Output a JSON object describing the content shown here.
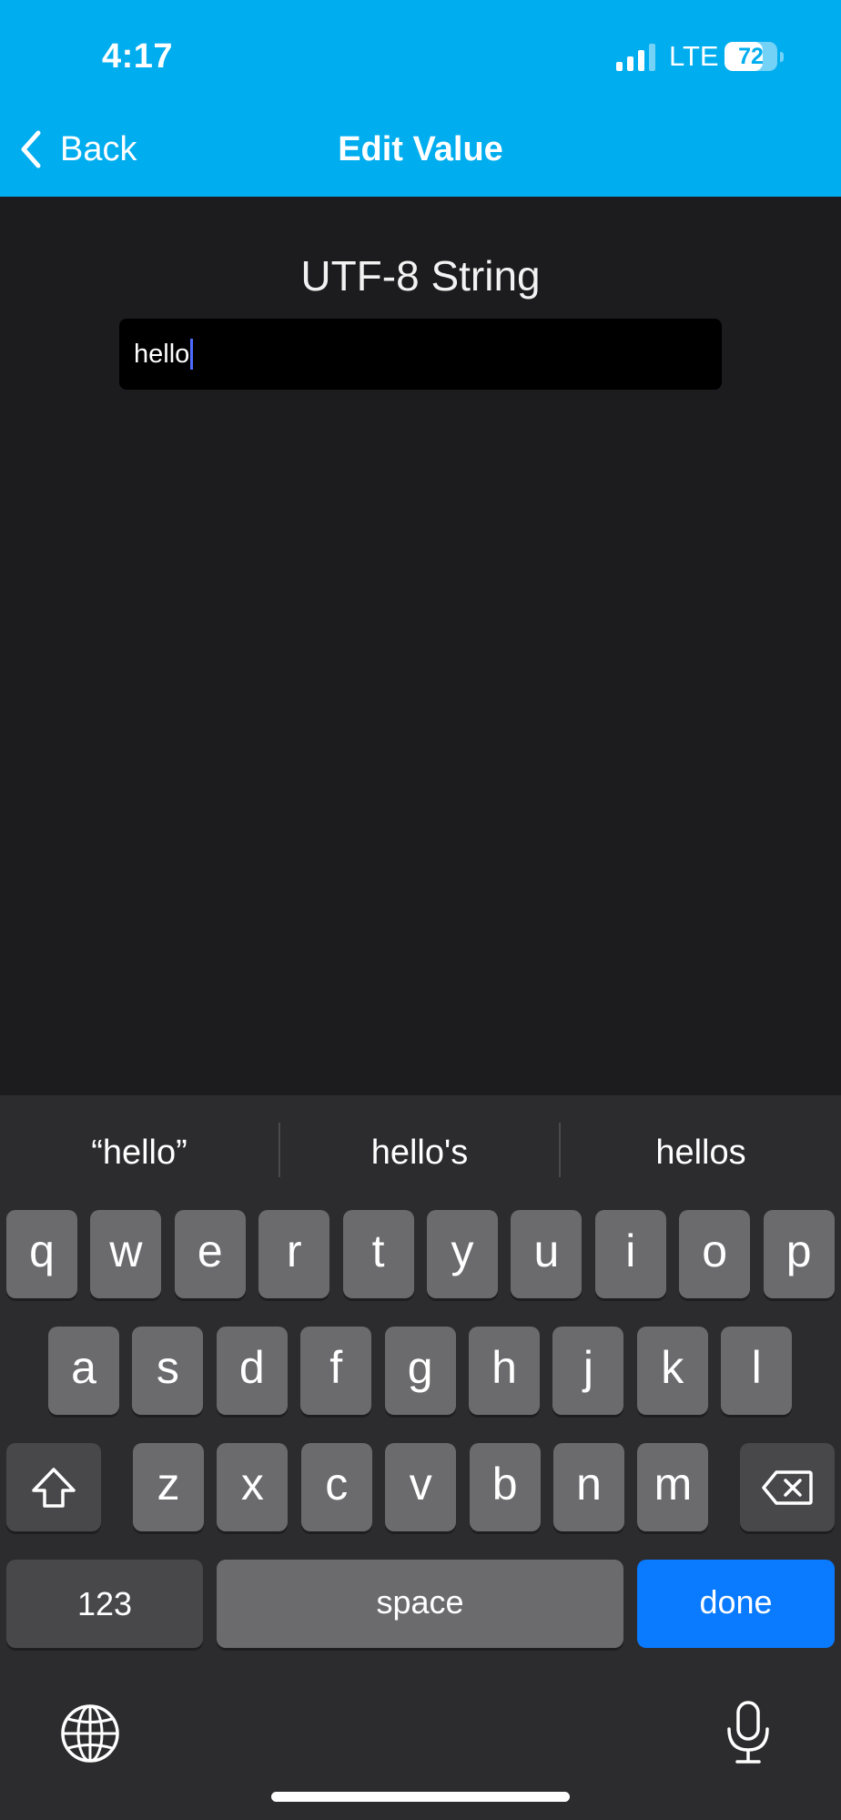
{
  "status_bar": {
    "time": "4:17",
    "network": "LTE",
    "battery_level": "72",
    "battery_fraction": 0.72
  },
  "nav": {
    "back_label": "Back",
    "title": "Edit Value"
  },
  "editor": {
    "field_label": "UTF-8 String",
    "value": "hello"
  },
  "keyboard": {
    "suggestions": [
      "“hello”",
      "hello's",
      "hellos"
    ],
    "row1": [
      "q",
      "w",
      "e",
      "r",
      "t",
      "y",
      "u",
      "i",
      "o",
      "p"
    ],
    "row2": [
      "a",
      "s",
      "d",
      "f",
      "g",
      "h",
      "j",
      "k",
      "l"
    ],
    "row3": [
      "z",
      "x",
      "c",
      "v",
      "b",
      "n",
      "m"
    ],
    "numbers_label": "123",
    "space_label": "space",
    "done_label": "done"
  },
  "colors": {
    "header": "#00adee",
    "background": "#1c1c1e",
    "done_key": "#0a7aff"
  }
}
